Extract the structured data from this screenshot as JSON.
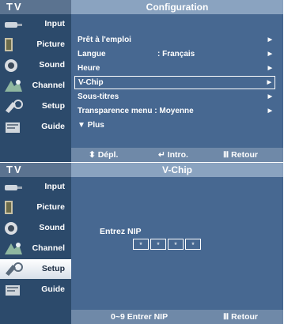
{
  "sidebar": {
    "items": [
      {
        "label": "Input"
      },
      {
        "label": "Picture"
      },
      {
        "label": "Sound"
      },
      {
        "label": "Channel"
      },
      {
        "label": "Setup"
      },
      {
        "label": "Guide"
      }
    ]
  },
  "panel1": {
    "tv_label": "TV",
    "title": "Configuration",
    "menu": [
      {
        "label": "Prêt à l'emploi",
        "value": "",
        "arrow": "▶"
      },
      {
        "label": "Langue",
        "value": ": Français",
        "arrow": "▶"
      },
      {
        "label": "Heure",
        "value": "",
        "arrow": "▶"
      },
      {
        "label": "V-Chip",
        "value": "",
        "arrow": "▶"
      },
      {
        "label": "Sous-titres",
        "value": "",
        "arrow": "▶"
      },
      {
        "label": "Transparence menu : Moyenne",
        "value": "",
        "arrow": "▶"
      },
      {
        "label": "▼ Plus",
        "value": "",
        "arrow": ""
      }
    ],
    "selected_index": 3,
    "bottom": {
      "move": "⬍ Dépl.",
      "enter": "↵ Intro.",
      "back": "Ⅲ Retour"
    }
  },
  "panel2": {
    "tv_label": "TV",
    "title": "V-Chip",
    "pin_label": "Entrez NIP",
    "pin_digits": [
      "*",
      "*",
      "*",
      "*"
    ],
    "bottom": {
      "hint": "0~9 Entrer NIP",
      "back": "Ⅲ Retour"
    }
  },
  "colors": {
    "panel_bg": "#2c4a6b",
    "content_bg": "#476891",
    "title_bar": "#8aa3c0",
    "bottom_bar": "#6f89a8"
  }
}
